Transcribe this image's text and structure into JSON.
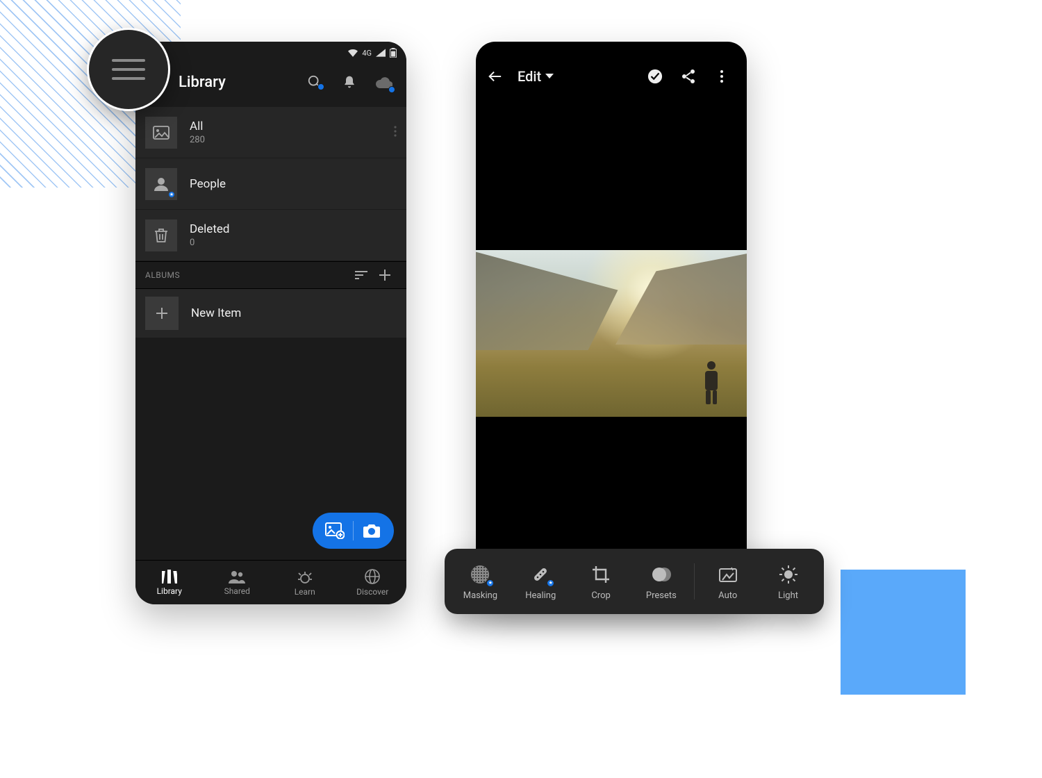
{
  "library": {
    "status": {
      "network_label": "4G"
    },
    "header": {
      "title": "Library"
    },
    "rows": {
      "all": {
        "label": "All",
        "count": "280"
      },
      "people": {
        "label": "People"
      },
      "deleted": {
        "label": "Deleted",
        "count": "0"
      }
    },
    "albums": {
      "section_label": "ALBUMS",
      "new_item_label": "New Item"
    },
    "bottom_nav": {
      "library": "Library",
      "shared": "Shared",
      "learn": "Learn",
      "discover": "Discover"
    }
  },
  "edit": {
    "header": {
      "title": "Edit"
    },
    "toolbar": {
      "masking": "Masking",
      "healing": "Healing",
      "crop": "Crop",
      "presets": "Presets",
      "auto": "Auto",
      "light": "Light"
    }
  }
}
